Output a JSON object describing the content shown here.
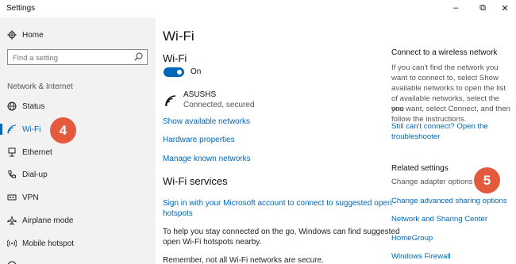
{
  "window": {
    "title": "Settings",
    "minimize_glyph": "–",
    "maximize_glyph": "⧉",
    "close_glyph": "✕"
  },
  "sidebar": {
    "home_label": "Home",
    "search_placeholder": "Find a setting",
    "section_label": "Network & Internet",
    "items": [
      {
        "label": "Status",
        "icon": "globe-icon"
      },
      {
        "label": "Wi-Fi",
        "icon": "wifi-icon",
        "active": true
      },
      {
        "label": "Ethernet",
        "icon": "ethernet-icon"
      },
      {
        "label": "Dial-up",
        "icon": "phone-icon"
      },
      {
        "label": "VPN",
        "icon": "vpn-icon"
      },
      {
        "label": "Airplane mode",
        "icon": "airplane-icon"
      },
      {
        "label": "Mobile hotspot",
        "icon": "hotspot-icon"
      }
    ]
  },
  "badges": {
    "step4": "4",
    "step5": "5",
    "color": "#e55a3c"
  },
  "main": {
    "title": "Wi-Fi",
    "wifi_heading": "Wi-Fi",
    "toggle_label": "On",
    "toggle_on": true,
    "network": {
      "name": "ASUSHS",
      "status": "Connected, secured"
    },
    "links": {
      "show_networks": "Show available networks",
      "hardware_properties": "Hardware properties",
      "manage_networks": "Manage known networks"
    },
    "services_heading": "Wi-Fi services",
    "signin_link_1": "Sign in with your Microsoft account to connect to suggested open",
    "signin_link_2": "hotspots",
    "help_text_1": "To help you stay connected on the go, Windows can find suggested",
    "help_text_2": "open Wi-Fi hotspots nearby.",
    "remember_text": "Remember, not all Wi-Fi networks are secure."
  },
  "right": {
    "connect_heading": "Connect to a wireless network",
    "connect_text": [
      "If you can't find the network you",
      "want to connect to, select Show",
      "available networks to open the list",
      "of available networks, select the one",
      "you want, select Connect, and then",
      "follow the instructions."
    ],
    "troubleshoot_1": "Still can't connect? Open the",
    "troubleshoot_2": "troubleshooter",
    "related_heading": "Related settings",
    "change_adapter": "Change adapter options",
    "advanced_sharing": "Change advanced sharing options",
    "network_center": "Network and Sharing Center",
    "homegroup": "HomeGroup",
    "firewall": "Windows Firewall"
  },
  "colors": {
    "accent": "#0067b8",
    "sidebar_bg": "#f2f2f2"
  }
}
